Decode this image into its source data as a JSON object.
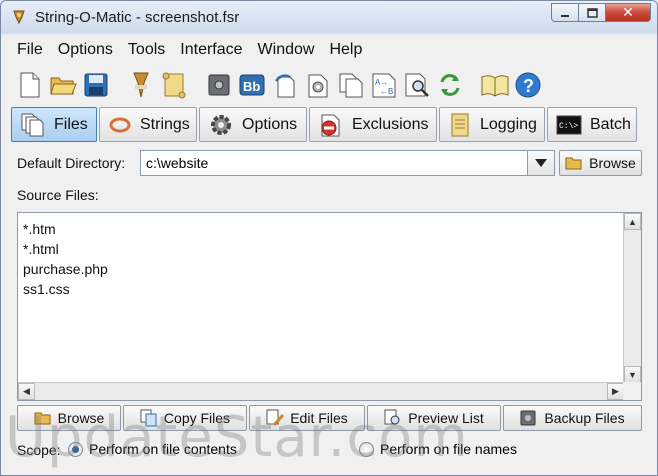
{
  "window": {
    "title": "String-O-Matic - screenshot.fsr",
    "close_glyph": "✕"
  },
  "menu": [
    "File",
    "Options",
    "Tools",
    "Interface",
    "Window",
    "Help"
  ],
  "toolbar_icons": [
    "new-file-icon",
    "open-folder-icon",
    "save-disk-icon",
    "broom-icon",
    "scroll-icon",
    "safe-icon",
    "bold-text-icon",
    "undo-doc-icon",
    "gear-doc-icon",
    "copy-docs-icon",
    "translate-icon",
    "search-doc-icon",
    "refresh-icon",
    "book-icon",
    "help-icon"
  ],
  "tabs": [
    {
      "label": "Files",
      "active": true
    },
    {
      "label": "Strings",
      "active": false
    },
    {
      "label": "Options",
      "active": false
    },
    {
      "label": "Exclusions",
      "active": false
    },
    {
      "label": "Logging",
      "active": false
    },
    {
      "label": "Batch",
      "active": false
    }
  ],
  "files": {
    "default_dir_label": "Default Directory:",
    "default_dir_value": "c:\\website",
    "browse_label": "Browse",
    "source_files_label": "Source Files:",
    "source_files": [
      "*.htm",
      "*.html",
      "purchase.php",
      "ss1.css"
    ],
    "buttons": {
      "browse": "Browse",
      "copy": "Copy Files",
      "edit": "Edit Files",
      "preview": "Preview List",
      "backup": "Backup Files"
    },
    "scope_label": "Scope:",
    "scope_options": [
      "Perform on file contents",
      "Perform on file names"
    ],
    "scope_selected": "Perform on file contents"
  },
  "watermark": "UpdateStar.com",
  "colors": {
    "accent": "#3c7fb1",
    "active_tab": "#a9cfef",
    "close_button": "#c8493a"
  }
}
